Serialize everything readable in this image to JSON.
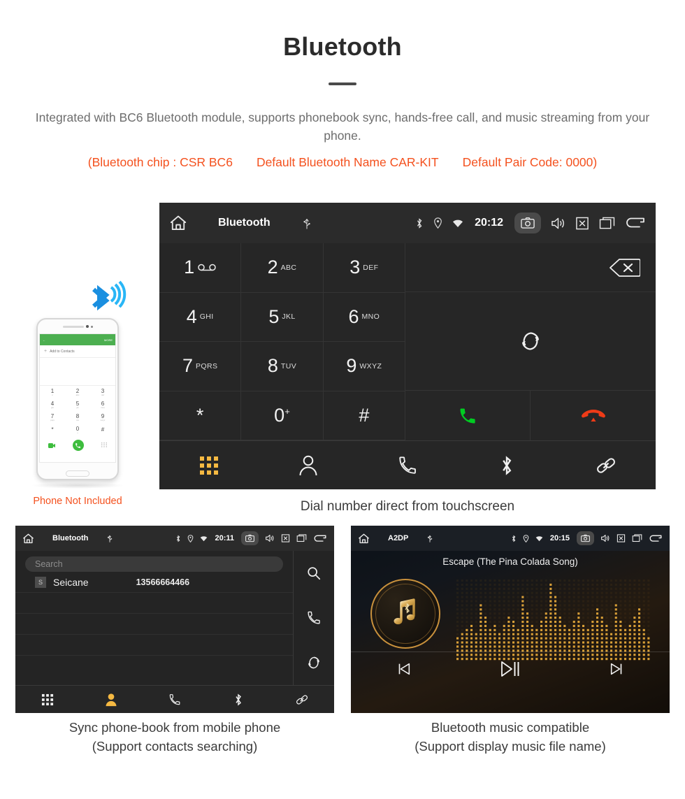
{
  "header": {
    "title": "Bluetooth",
    "description": "Integrated with BC6 Bluetooth module, supports phonebook sync, hands-free call, and music streaming from your phone.",
    "specs": [
      "(Bluetooth chip : CSR BC6",
      "Default Bluetooth Name CAR-KIT",
      "Default Pair Code: 0000)"
    ],
    "accent_color": "#f4511e",
    "text_color": "#6d6d6d"
  },
  "main_screen": {
    "statusbar": {
      "home_icon": "home-icon",
      "title": "Bluetooth",
      "usb_icon": "usb-icon",
      "bluetooth_icon": "bluetooth-icon",
      "location_icon": "location-icon",
      "wifi_icon": "wifi-icon",
      "time": "20:12",
      "camera_icon": "camera-icon",
      "volume_icon": "volume-icon",
      "close_icon": "close-box-icon",
      "recents_icon": "recents-icon",
      "back_icon": "back-icon"
    },
    "keypad": [
      {
        "num": "1",
        "sub": "",
        "voicemail": true
      },
      {
        "num": "2",
        "sub": "ABC",
        "voicemail": false
      },
      {
        "num": "3",
        "sub": "DEF",
        "voicemail": false
      },
      {
        "num": "4",
        "sub": "GHI",
        "voicemail": false
      },
      {
        "num": "5",
        "sub": "JKL",
        "voicemail": false
      },
      {
        "num": "6",
        "sub": "MNO",
        "voicemail": false
      },
      {
        "num": "7",
        "sub": "PQRS",
        "voicemail": false
      },
      {
        "num": "8",
        "sub": "TUV",
        "voicemail": false
      },
      {
        "num": "9",
        "sub": "WXYZ",
        "voicemail": false
      },
      {
        "num": "*",
        "sub": "",
        "voicemail": false
      },
      {
        "num": "0",
        "sub": "",
        "plus": "+",
        "voicemail": false
      },
      {
        "num": "#",
        "sub": "",
        "voicemail": false
      }
    ],
    "actions": {
      "backspace_icon": "backspace-icon",
      "transfer_icon": "call-transfer-icon",
      "call_icon": "call-icon",
      "call_color": "#00cc22",
      "end_call_icon": "end-call-icon",
      "end_call_color": "#ee3b17"
    },
    "navbar": {
      "active_color": "#f5b942",
      "items": [
        {
          "icon": "dialpad-icon",
          "label": "Dialpad",
          "active": true
        },
        {
          "icon": "contacts-icon",
          "label": "Contacts",
          "active": false
        },
        {
          "icon": "call-log-icon",
          "label": "Call log",
          "active": false
        },
        {
          "icon": "bluetooth-icon",
          "label": "Bluetooth",
          "active": false
        },
        {
          "icon": "link-icon",
          "label": "Pair",
          "active": false
        }
      ]
    },
    "caption": "Dial number direct from touchscreen"
  },
  "phone_mock": {
    "bluetooth_icon": "bluetooth-signal-icon",
    "app_back_label": "←",
    "app_more_label": "MORE",
    "add_contact_label": "Add to Contacts",
    "keys": [
      {
        "num": "1",
        "sub": "∞"
      },
      {
        "num": "2",
        "sub": "abc"
      },
      {
        "num": "3",
        "sub": "def"
      },
      {
        "num": "4",
        "sub": "ghi"
      },
      {
        "num": "5",
        "sub": "jkl"
      },
      {
        "num": "6",
        "sub": "mno"
      },
      {
        "num": "7",
        "sub": "pqrs"
      },
      {
        "num": "8",
        "sub": "tuv"
      },
      {
        "num": "9",
        "sub": "wxyz"
      },
      {
        "num": "*",
        "sub": ""
      },
      {
        "num": "0",
        "sub": "+"
      },
      {
        "num": "#",
        "sub": ""
      }
    ],
    "caption": "Phone Not Included",
    "caption_color": "#f4511e"
  },
  "phonebook_screen": {
    "statusbar": {
      "home_icon": "home-icon",
      "title": "Bluetooth",
      "usb_icon": "usb-icon",
      "time": "20:11",
      "camera_icon": "camera-icon",
      "volume_icon": "volume-icon",
      "close_icon": "close-box-icon",
      "recents_icon": "recents-icon",
      "back_icon": "back-icon"
    },
    "search_placeholder": "Search",
    "contacts": [
      {
        "initial": "S",
        "name": "Seicane",
        "number": "13566664466"
      }
    ],
    "rail": [
      {
        "icon": "search-icon",
        "label": "Search"
      },
      {
        "icon": "call-icon",
        "label": "Call"
      },
      {
        "icon": "sync-icon",
        "label": "Sync"
      }
    ],
    "navbar": {
      "active_color": "#f5b942",
      "items": [
        {
          "icon": "dialpad-icon",
          "label": "Dialpad",
          "active": false
        },
        {
          "icon": "contacts-icon",
          "label": "Contacts",
          "active": true
        },
        {
          "icon": "call-log-icon",
          "label": "Call log",
          "active": false
        },
        {
          "icon": "bluetooth-icon",
          "label": "Bluetooth",
          "active": false
        },
        {
          "icon": "link-icon",
          "label": "Pair",
          "active": false
        }
      ]
    },
    "caption_line1": "Sync phone-book from mobile phone",
    "caption_line2": "(Support contacts searching)"
  },
  "music_screen": {
    "statusbar": {
      "home_icon": "home-icon",
      "title": "A2DP",
      "usb_icon": "usb-icon",
      "time": "20:15",
      "camera_icon": "camera-icon",
      "volume_icon": "volume-icon",
      "close_icon": "close-box-icon",
      "recents_icon": "recents-icon",
      "back_icon": "back-icon"
    },
    "song_title": "Escape (The Pina Colada Song)",
    "album_art_icon": "music-note-bluetooth-icon",
    "accent_color": "#c9913c",
    "controls": [
      {
        "icon": "previous-track-icon",
        "label": "Previous"
      },
      {
        "icon": "play-pause-icon",
        "label": "Play / Pause"
      },
      {
        "icon": "next-track-icon",
        "label": "Next"
      }
    ],
    "caption_line1": "Bluetooth music compatible",
    "caption_line2": "(Support display music file name)"
  }
}
